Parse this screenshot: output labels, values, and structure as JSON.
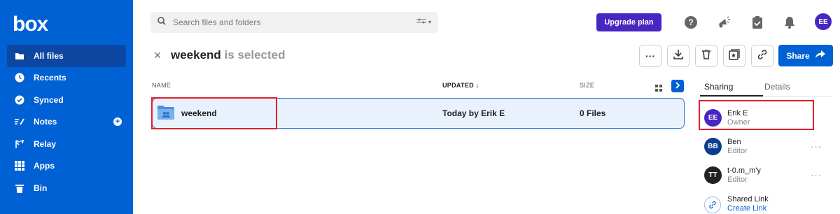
{
  "brand": {
    "logo_text": "box"
  },
  "sidebar": {
    "items": [
      {
        "label": "All files",
        "icon": "folder-icon",
        "active": true
      },
      {
        "label": "Recents",
        "icon": "clock-icon"
      },
      {
        "label": "Synced",
        "icon": "check-circle-icon"
      },
      {
        "label": "Notes",
        "icon": "notes-icon",
        "has_add": true
      },
      {
        "label": "Relay",
        "icon": "relay-icon"
      },
      {
        "label": "Apps",
        "icon": "grid-icon"
      },
      {
        "label": "Bin",
        "icon": "trash-icon"
      }
    ]
  },
  "header": {
    "search_placeholder": "Search files and folders",
    "upgrade_label": "Upgrade plan",
    "avatar_initials": "EE"
  },
  "selection": {
    "name": "weekend",
    "suffix": " is selected",
    "share_label": "Share",
    "more_label": "···"
  },
  "table": {
    "headers": {
      "name": "NAME",
      "updated": "UPDATED ↓",
      "size": "SIZE"
    },
    "rows": [
      {
        "name": "weekend",
        "updated": "Today by Erik E",
        "size": "0 Files"
      }
    ]
  },
  "panel": {
    "tabs": {
      "sharing": "Sharing",
      "details": "Details"
    },
    "users": [
      {
        "initials": "EE",
        "name": "Erik E",
        "role": "Owner",
        "color": "#4826c2"
      },
      {
        "initials": "BB",
        "name": "Ben",
        "role": "Editor",
        "color": "#0a3d8f"
      },
      {
        "initials": "TT",
        "name": "t-0.m_m'y",
        "role": "Editor",
        "color": "#222222"
      }
    ],
    "more_label": "···",
    "shared_link_title": "Shared Link",
    "create_link_label": "Create Link"
  },
  "colors": {
    "brand_blue": "#0061d5",
    "upgrade_purple": "#4826c2",
    "highlight_red": "#e0202a"
  }
}
